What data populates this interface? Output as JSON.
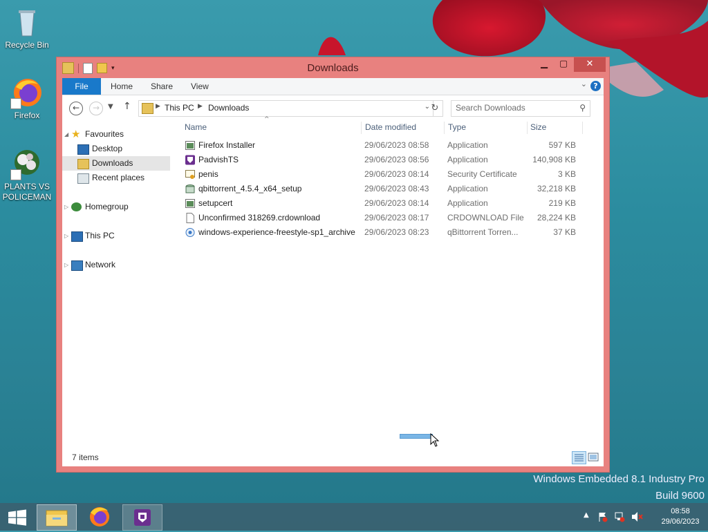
{
  "desktop": {
    "icons": [
      {
        "label": "Recycle Bin"
      },
      {
        "label": "Firefox"
      },
      {
        "label": "PLANTS VS POLICEMAN"
      }
    ],
    "watermark_line1": "Windows Embedded 8.1 Industry Pro",
    "watermark_line2": "Build 9600"
  },
  "window": {
    "title": "Downloads",
    "close_symbol": "✕",
    "ribbon_tabs": {
      "file": "File",
      "home": "Home",
      "share": "Share",
      "view": "View"
    },
    "help_symbol": "?",
    "address": {
      "crumbs": [
        "This PC",
        "Downloads"
      ]
    },
    "search": {
      "placeholder": "Search Downloads"
    },
    "nav_tree": {
      "favourites": "Favourites",
      "desktop": "Desktop",
      "downloads": "Downloads",
      "recent": "Recent places",
      "homegroup": "Homegroup",
      "thispc": "This PC",
      "network": "Network"
    },
    "columns": {
      "name": "Name",
      "date": "Date modified",
      "type": "Type",
      "size": "Size"
    },
    "files": [
      {
        "name": "Firefox Installer",
        "date": "29/06/2023 08:58",
        "type": "Application",
        "size": "597 KB",
        "icon": "app-icon"
      },
      {
        "name": "PadvishTS",
        "date": "29/06/2023 08:56",
        "type": "Application",
        "size": "140,908 KB",
        "icon": "padvish-icon"
      },
      {
        "name": "penis",
        "date": "29/06/2023 08:14",
        "type": "Security Certificate",
        "size": "3 KB",
        "icon": "certificate-icon"
      },
      {
        "name": "qbittorrent_4.5.4_x64_setup",
        "date": "29/06/2023 08:43",
        "type": "Application",
        "size": "32,218 KB",
        "icon": "installer-icon"
      },
      {
        "name": "setupcert",
        "date": "29/06/2023 08:14",
        "type": "Application",
        "size": "219 KB",
        "icon": "app-icon"
      },
      {
        "name": "Unconfirmed 318269.crdownload",
        "date": "29/06/2023 08:17",
        "type": "CRDOWNLOAD File",
        "size": "28,224 KB",
        "icon": "blank-file-icon"
      },
      {
        "name": "windows-experience-freestyle-sp1_archive",
        "date": "29/06/2023 08:23",
        "type": "qBittorrent Torren...",
        "size": "37 KB",
        "icon": "torrent-icon"
      }
    ],
    "status": {
      "item_count": "7 items"
    }
  },
  "taskbar": {
    "clock_time": "08:58",
    "clock_date": "29/06/2023"
  }
}
